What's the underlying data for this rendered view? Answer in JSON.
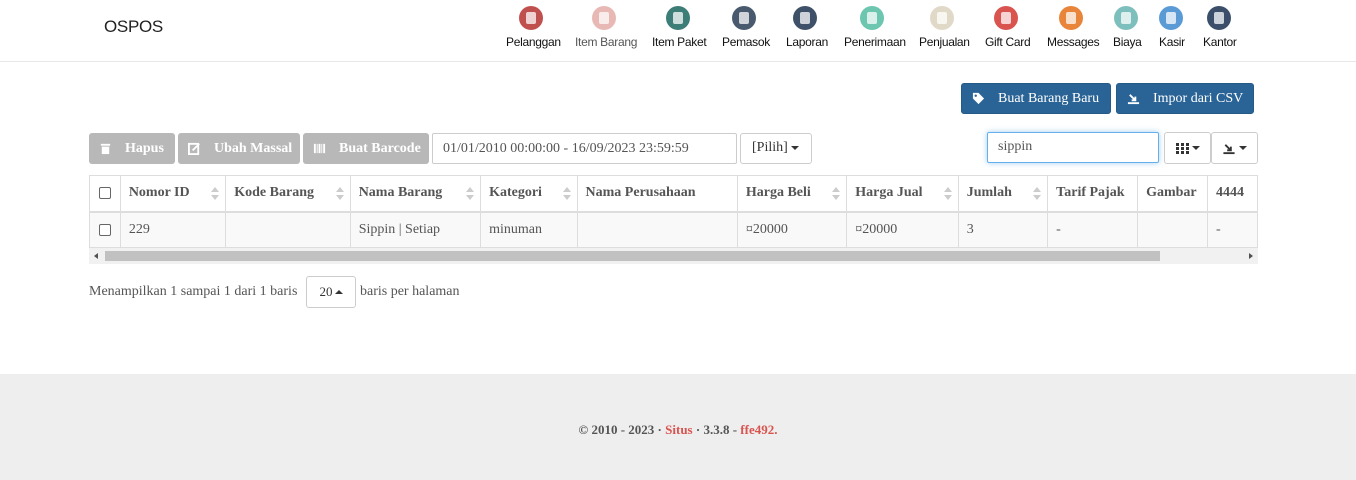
{
  "brand": "OSPOS",
  "nav": [
    {
      "label": "Pelanggan",
      "icon": "customers-icon",
      "color": "#c0504d"
    },
    {
      "label": "Item Barang",
      "icon": "items-tag-icon",
      "color": "#e8b9b4",
      "active": true
    },
    {
      "label": "Item Paket",
      "icon": "item-kits-icon",
      "color": "#3d7d78"
    },
    {
      "label": "Pemasok",
      "icon": "suppliers-briefcase-icon",
      "color": "#4a5a6e"
    },
    {
      "label": "Laporan",
      "icon": "reports-chart-icon",
      "color": "#3f5168"
    },
    {
      "label": "Penerimaan",
      "icon": "receivings-icon",
      "color": "#6cc6b0"
    },
    {
      "label": "Penjualan",
      "icon": "sales-basket-icon",
      "color": "#e0d9c8"
    },
    {
      "label": "Gift Card",
      "icon": "gift-card-heart-icon",
      "color": "#d9534f"
    },
    {
      "label": "Messages",
      "icon": "messages-phone-icon",
      "color": "#e8853a"
    },
    {
      "label": "Biaya",
      "icon": "expenses-icon",
      "color": "#7dbfbc"
    },
    {
      "label": "Kasir",
      "icon": "cashups-icon",
      "color": "#5b9bd5"
    },
    {
      "label": "Kantor",
      "icon": "office-icon",
      "color": "#3b4f6b"
    }
  ],
  "actions": {
    "new_item": "Buat Barang Baru",
    "import_csv": "Impor dari CSV",
    "delete": "Hapus",
    "bulk_edit": "Ubah Massal",
    "barcode": "Buat Barcode"
  },
  "filters": {
    "daterange": "01/01/2010 00:00:00 - 16/09/2023 23:59:59",
    "select": "[Pilih]",
    "search_value": "sippin"
  },
  "table": {
    "headers": [
      "Nomor ID",
      "Kode Barang",
      "Nama Barang",
      "Kategori",
      "Nama Perusahaan",
      "Harga Beli",
      "Harga Jual",
      "Jumlah",
      "Tarif Pajak",
      "Gambar",
      "4444"
    ],
    "rows": [
      [
        "229",
        "",
        "Sippin | Setiap",
        "minuman",
        "",
        "¤20000",
        "¤20000",
        "3",
        "-",
        "",
        "-"
      ]
    ]
  },
  "pagination": {
    "showing": "Menampilkan 1 sampai 1 dari 1 baris",
    "page_size": "20",
    "per_page_suffix": "baris per halaman"
  },
  "footer": {
    "copyright": "© 2010 - 2023 · ",
    "site": "Situs",
    "version": " · 3.3.8 - ",
    "commit": "ffe492."
  },
  "colors": {
    "primary": "#2a6496",
    "disabled": "#b8b8b8",
    "footer_bg": "#eeeeee",
    "link_red": "#d9534f"
  }
}
